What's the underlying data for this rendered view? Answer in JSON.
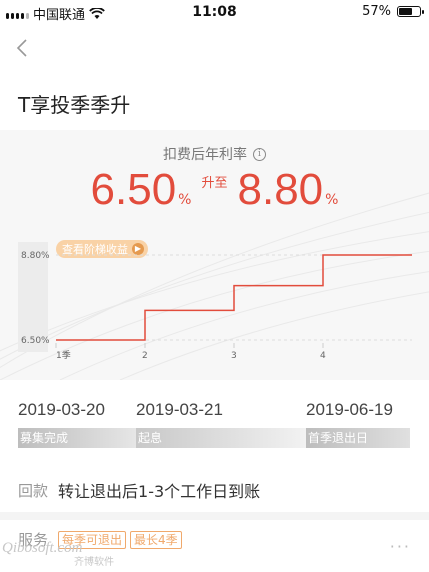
{
  "status_bar": {
    "carrier": "中国联通",
    "time": "11:08",
    "battery": "57%",
    "battery_level": 0.57
  },
  "nav": {
    "back_icon": "chevron-left-icon"
  },
  "page": {
    "title": "T享投季季升"
  },
  "rate": {
    "label": "扣费后年利率",
    "from_value": "6.50",
    "to_value": "8.80",
    "percent_sign": "%",
    "connector": "升至",
    "info_icon": "info-icon"
  },
  "tier_button": {
    "label": "查看阶梯收益",
    "icon": "chevron-right-icon"
  },
  "chart_data": {
    "type": "line",
    "step": true,
    "categories": [
      "1季",
      "2",
      "3",
      "4"
    ],
    "y_tick_labels": [
      "8.80%",
      "6.50%"
    ],
    "series": [
      {
        "values": [
          6.5,
          7.3,
          7.97,
          8.8
        ]
      }
    ],
    "ylim": [
      6.5,
      8.8
    ],
    "line_color": "#e24c3c",
    "grid": true
  },
  "timeline": {
    "dates": [
      "2019-03-20",
      "2019-03-21",
      "2019-06-19"
    ],
    "stages": [
      "募集完成",
      "起息",
      "首季退出日"
    ]
  },
  "repay": {
    "label": "回款",
    "value": "转让退出后1-3个工作日到账"
  },
  "service": {
    "label": "服务",
    "tags": [
      "每季可退出",
      "最长4季"
    ],
    "more": "···"
  },
  "watermark": {
    "brand": "Qibosoft.com",
    "cn": "齐博软件"
  },
  "colors": {
    "accent": "#e24c3c",
    "tag": "#f0a96c",
    "stage_bar": "#c8c8c8"
  }
}
